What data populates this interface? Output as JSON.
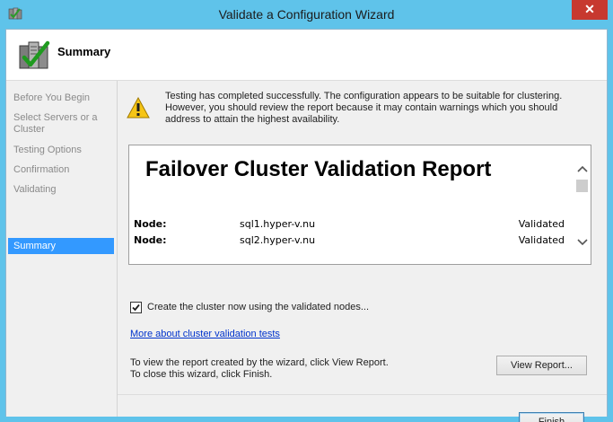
{
  "window": {
    "title": "Validate a Configuration Wizard",
    "close_glyph": "✕"
  },
  "header": {
    "title": "Summary",
    "icon": "cluster-validation-icon"
  },
  "nav": {
    "items": [
      {
        "label": "Before You Begin",
        "active": false
      },
      {
        "label": "Select Servers or a Cluster",
        "active": false
      },
      {
        "label": "Testing Options",
        "active": false
      },
      {
        "label": "Confirmation",
        "active": false
      },
      {
        "label": "Validating",
        "active": false
      },
      {
        "label": "Summary",
        "active": true
      }
    ]
  },
  "status": {
    "icon": "warning-icon",
    "message": "Testing has completed successfully. The configuration appears to be suitable for clustering. However, you should review the report because it may contain warnings which you should address to attain the highest availability."
  },
  "report": {
    "title": "Failover Cluster Validation Report",
    "rows": [
      {
        "label": "Node:",
        "name": "sql1.hyper-v.nu",
        "status": "Validated"
      },
      {
        "label": "Node:",
        "name": "sql2.hyper-v.nu",
        "status": "Validated"
      }
    ]
  },
  "options": {
    "create_cluster_label": "Create the cluster now using the validated nodes...",
    "create_cluster_checked": true
  },
  "link": {
    "text": "More about cluster validation tests"
  },
  "instructions": {
    "line1": "To view the report created by the wizard, click View Report.",
    "line2": "To close this wizard, click Finish."
  },
  "buttons": {
    "view_report": "View Report...",
    "finish": "Finish"
  },
  "colors": {
    "titlebar": "#5fc3ea",
    "close": "#c7392f",
    "nav_active": "#3399ff",
    "link": "#0033cc"
  }
}
